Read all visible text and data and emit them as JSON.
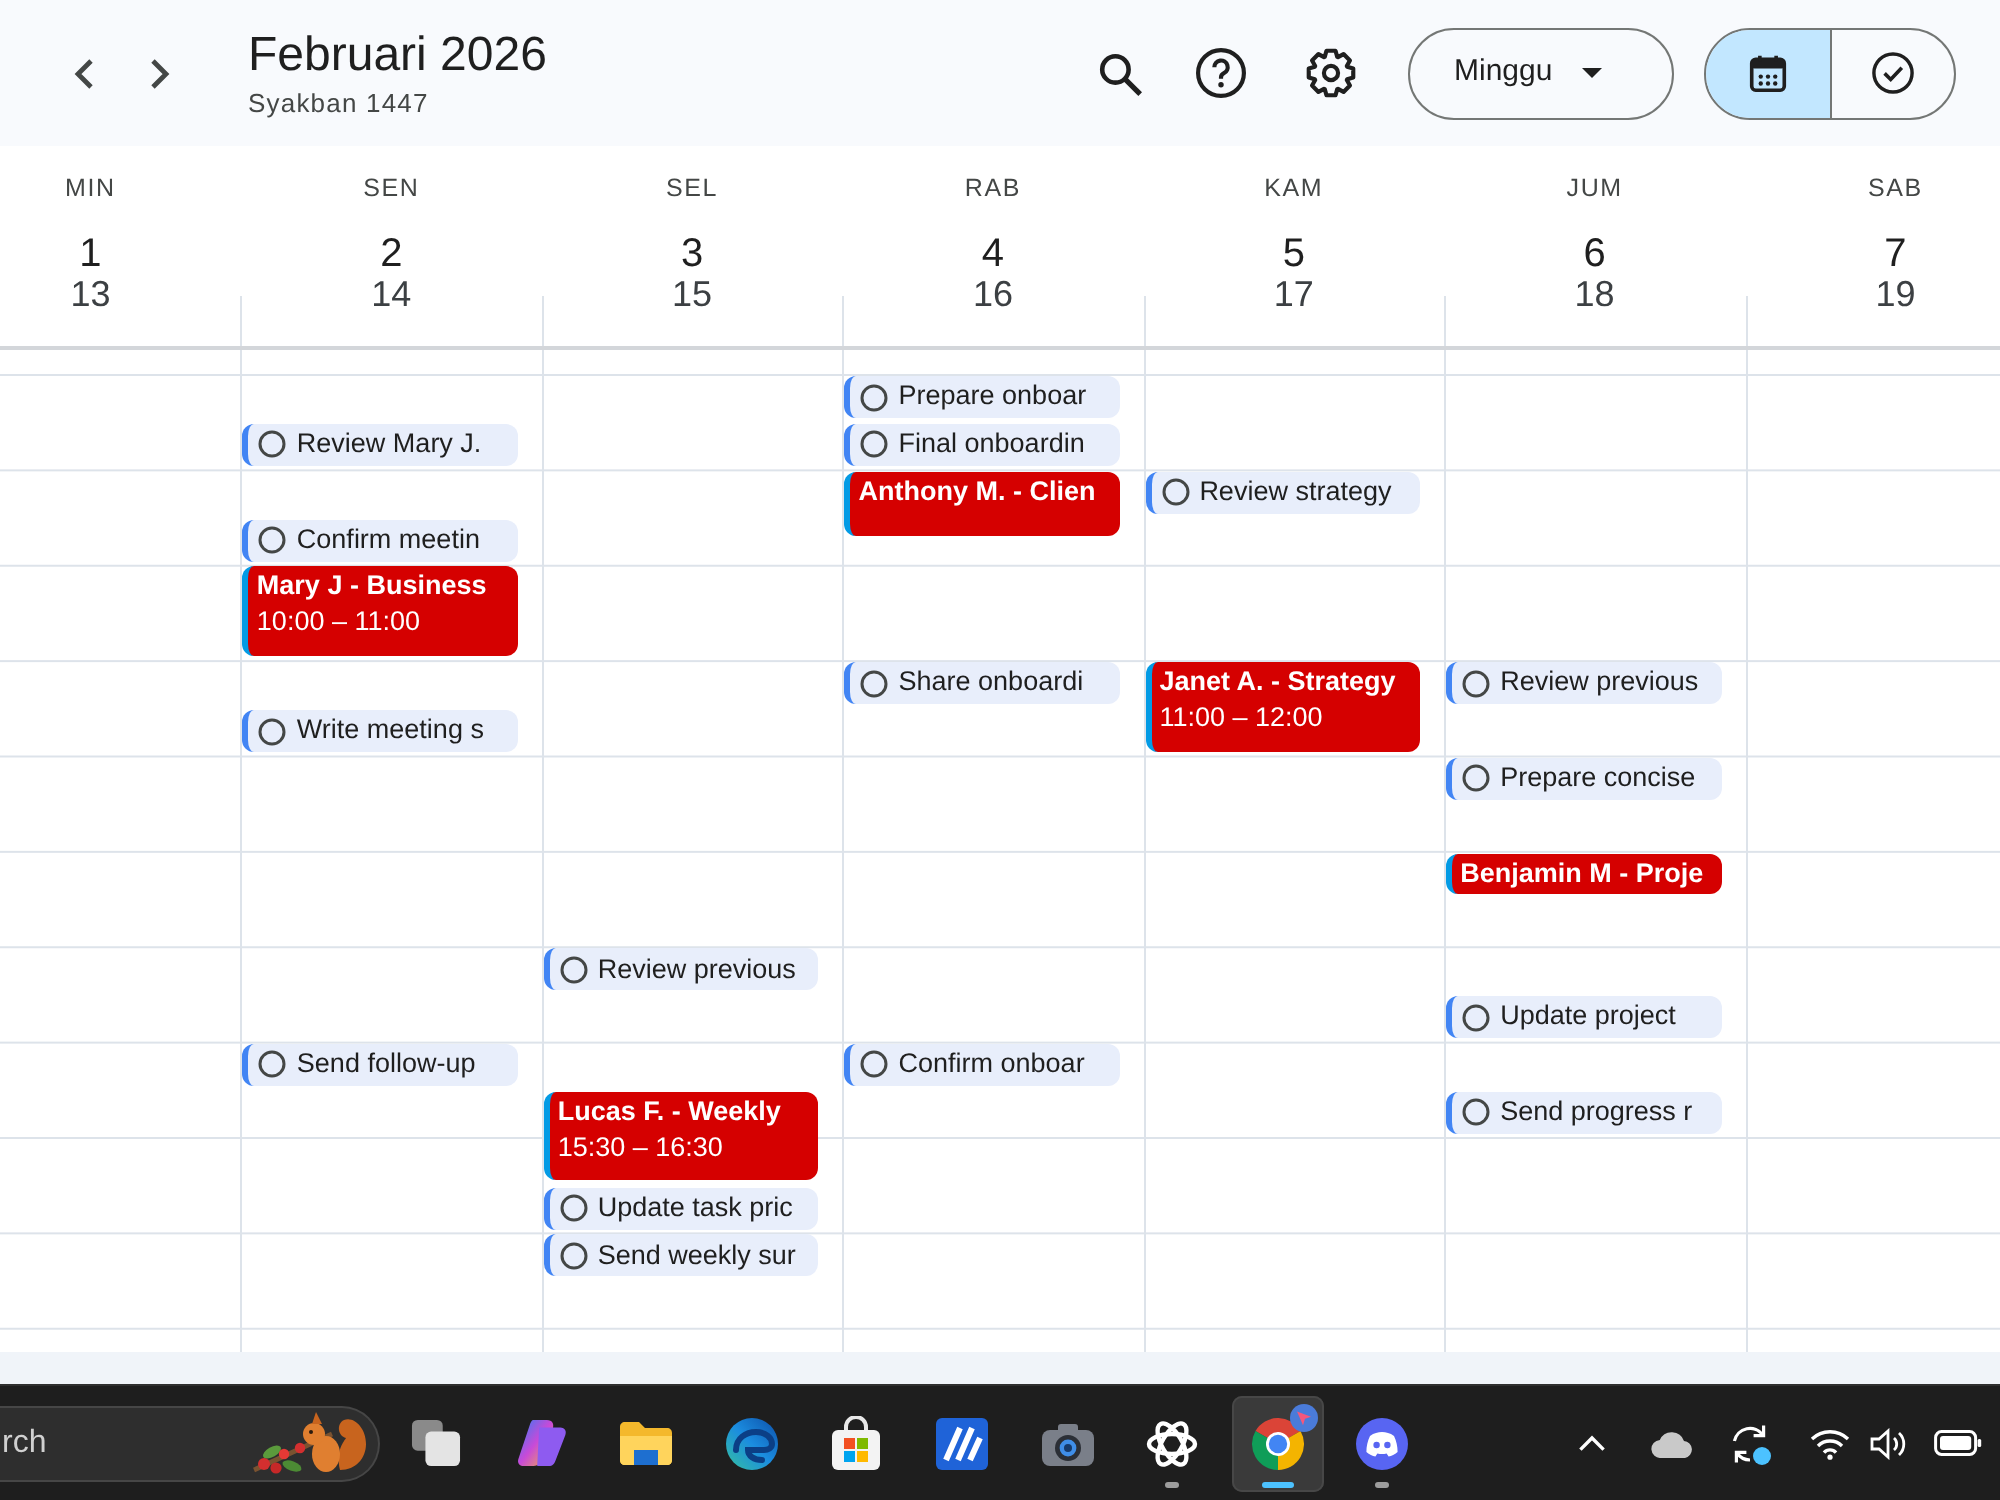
{
  "header": {
    "title": "Februari 2026",
    "subtitle": "Syakban 1447",
    "view_menu": {
      "label": "Minggu"
    },
    "view_toggle": [
      {
        "kind": "calendar",
        "selected": true
      },
      {
        "kind": "tasks",
        "selected": false
      }
    ]
  },
  "days": [
    {
      "name": "MIN",
      "date": "1",
      "hijri_date": "13"
    },
    {
      "name": "SEN",
      "date": "2",
      "hijri_date": "14",
      "items": [
        {
          "kind": "task",
          "title": "Review Mary J.",
          "completed": false
        },
        {
          "kind": "task",
          "title": "Confirm meetin",
          "completed": false
        },
        {
          "kind": "event",
          "title": "Mary J - Business",
          "time": "10:00 – 11:00"
        },
        {
          "kind": "task",
          "title": "Write meeting s",
          "completed": false
        },
        {
          "kind": "task",
          "title": "Send follow-up",
          "completed": false
        }
      ]
    },
    {
      "name": "SEL",
      "date": "3",
      "hijri_date": "15",
      "items": [
        {
          "kind": "task",
          "title": "Review previous",
          "completed": false
        },
        {
          "kind": "event",
          "title": "Lucas F. - Weekly",
          "time": "15:30 – 16:30"
        },
        {
          "kind": "task",
          "title": "Update task pric",
          "completed": false
        },
        {
          "kind": "task",
          "title": "Send weekly sur",
          "completed": false
        }
      ]
    },
    {
      "name": "RAB",
      "date": "4",
      "hijri_date": "16",
      "items": [
        {
          "kind": "task",
          "title": "Prepare onboar",
          "completed": false
        },
        {
          "kind": "task",
          "title": "Final onboardin",
          "completed": false
        },
        {
          "kind": "event",
          "title": "Anthony M. - Clien"
        },
        {
          "kind": "task",
          "title": "Share onboardi",
          "completed": false
        },
        {
          "kind": "task",
          "title": "Confirm onboar",
          "completed": false
        }
      ]
    },
    {
      "name": "KAM",
      "date": "5",
      "hijri_date": "17",
      "items": [
        {
          "kind": "task",
          "title": "Review strategy",
          "completed": false
        },
        {
          "kind": "event",
          "title": "Janet A. - Strategy",
          "time": "11:00 – 12:00"
        }
      ]
    },
    {
      "name": "JUM",
      "date": "6",
      "hijri_date": "18",
      "items": [
        {
          "kind": "task",
          "title": "Review previous",
          "completed": false
        },
        {
          "kind": "task",
          "title": "Prepare concise",
          "completed": false
        },
        {
          "kind": "event",
          "title": "Benjamin M - Proje"
        },
        {
          "kind": "task",
          "title": "Update project",
          "completed": false
        },
        {
          "kind": "task",
          "title": "Send progress r",
          "completed": false
        }
      ]
    },
    {
      "name": "SAB",
      "date": "7",
      "hijri_date": "19"
    }
  ],
  "taskbar": {
    "search": {
      "placeholder": "rch"
    },
    "apps": [
      {
        "kind": "task_view",
        "running": false,
        "selected": false
      },
      {
        "kind": "copilot",
        "running": false,
        "selected": false
      },
      {
        "kind": "files",
        "running": false,
        "selected": false
      },
      {
        "kind": "edge",
        "running": false,
        "selected": false
      },
      {
        "kind": "store",
        "running": false,
        "selected": false
      },
      {
        "kind": "tile",
        "running": false,
        "selected": false
      },
      {
        "kind": "camera",
        "running": false,
        "selected": false
      },
      {
        "kind": "chatgpt",
        "running": true,
        "selected": false
      },
      {
        "kind": "chrome",
        "running": true,
        "selected": true
      },
      {
        "kind": "discord",
        "running": true,
        "selected": false
      }
    ]
  }
}
